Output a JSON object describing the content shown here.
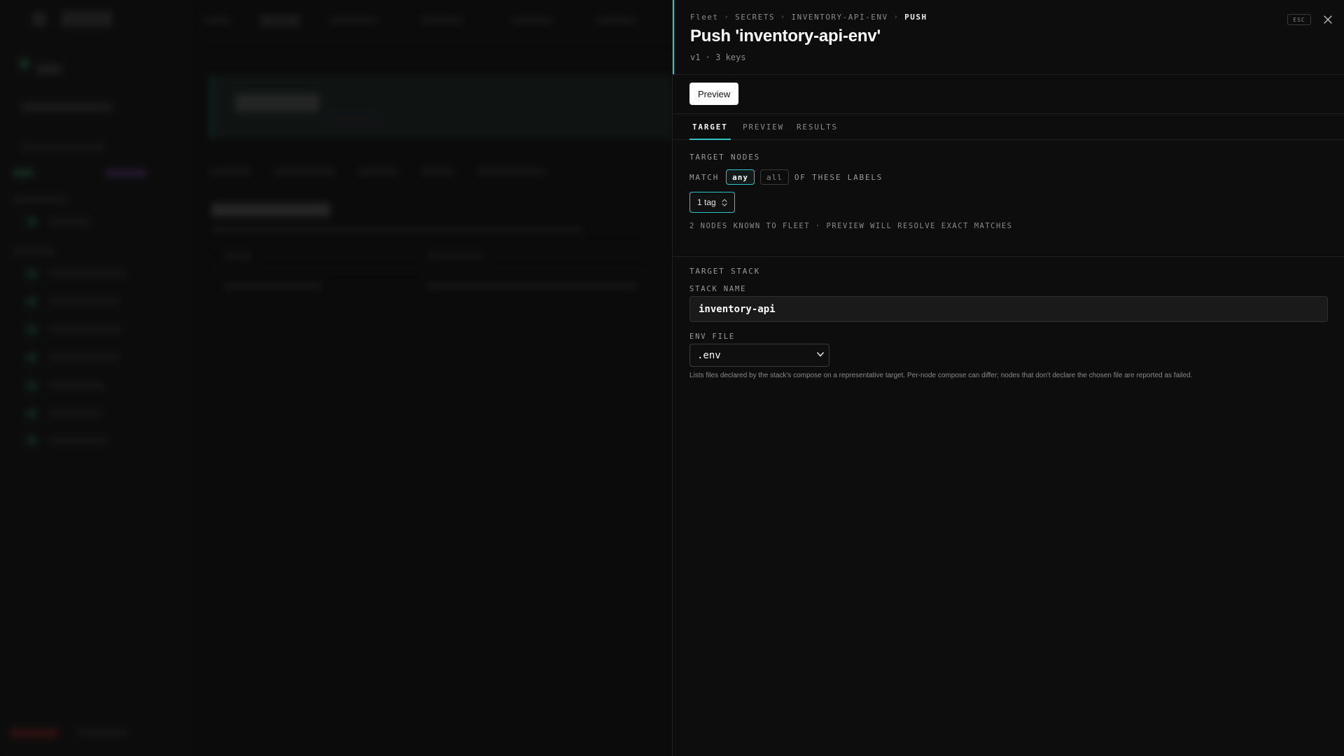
{
  "drawer": {
    "breadcrumb": [
      "Fleet",
      "SECRETS",
      "INVENTORY-API-ENV",
      "PUSH"
    ],
    "title": "Push 'inventory-api-env'",
    "subtitle": "v1 · 3 keys",
    "esc_label": "ESC",
    "icons": {
      "close": "close-icon",
      "chevron_updown": "chevron-updown-icon",
      "chevron_down": "chevron-down-icon"
    },
    "preview_button": "Preview",
    "tabs": [
      {
        "label": "TARGET",
        "active": true
      },
      {
        "label": "PREVIEW",
        "active": false
      },
      {
        "label": "RESULTS",
        "active": false
      }
    ],
    "target_nodes": {
      "heading": "TARGET NODES",
      "match_label": "MATCH",
      "options": [
        "any",
        "all"
      ],
      "selected": "any",
      "after_label": "OF THESE LABELS",
      "tag_button": "1 tag",
      "hint": "2 NODES KNOWN TO FLEET · PREVIEW WILL RESOLVE EXACT MATCHES"
    },
    "target_stack": {
      "heading": "TARGET STACK",
      "stack_name_label": "STACK NAME",
      "stack_name_value": "inventory-api",
      "env_file_label": "ENV FILE",
      "env_file_selected": ".env",
      "env_file_options": [
        ".env"
      ],
      "note": "Lists files declared by the stack's compose on a representative target. Per-node compose can differ; nodes that don't declare the chosen file are reported as failed."
    }
  },
  "colors": {
    "accent": "#2ec4c4",
    "background": "#0d0d0d",
    "primary_button": "#ffffff"
  }
}
